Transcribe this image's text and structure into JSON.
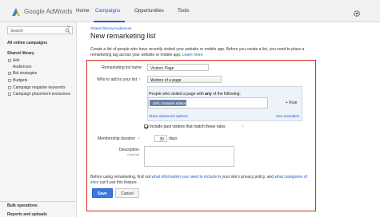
{
  "header": {
    "logo_text": "Google AdWords",
    "tabs": [
      {
        "label": "Home"
      },
      {
        "label": "Campaigns"
      },
      {
        "label": "Opportunities"
      },
      {
        "label": "Tools"
      }
    ],
    "active_tab": "Campaigns",
    "accent_color": "#1a5fcf"
  },
  "sidebar": {
    "search_placeholder": "Search",
    "all_campaigns": "All online campaigns",
    "shared_library": "Shared library",
    "items": [
      {
        "label": "Ads"
      },
      {
        "label": "Audiences"
      },
      {
        "label": "Bid strategies"
      },
      {
        "label": "Budgets"
      },
      {
        "label": "Campaign negative keywords"
      },
      {
        "label": "Campaign placement exclusions"
      }
    ],
    "bulk_operations": "Bulk operations",
    "reports_uploads": "Reports and uploads"
  },
  "main": {
    "breadcrumb": "Shared library/Audiences",
    "title": "New remarketing list",
    "intro_text": "Create a list of people who have recently visited your website or mobile app. Before you create a list, you need to place a remarketing tag across your website or mobile app.",
    "intro_link": "Learn more",
    "form": {
      "list_name_label": "Remarketing list name",
      "list_name_value": "Visitors Page",
      "who_label": "Who to add to your list",
      "who_value": "Visitors of a page",
      "rule_prefix": "People who visited a page with",
      "rule_any": "any",
      "rule_suffix": "of the following:",
      "rule_chip": "URL contains adwords",
      "add_rule": "+ Rule",
      "advanced_options": "Show advanced options",
      "see_examples": "See examples",
      "include_past_label": "Include past visitors that match these rules",
      "include_past_checked": true,
      "membership_label": "Membership duration",
      "membership_value": "30",
      "membership_unit": "days",
      "description_label": "Description",
      "description_optional": "Optional"
    },
    "footnote": {
      "prefix": "Before using remarketing, find out",
      "link1": "what information you need to include",
      "middle": "in your site's privacy policy, and",
      "link2": "what categories of sites",
      "suffix": "can't use this feature."
    },
    "save_label": "Save",
    "cancel_label": "Cancel"
  },
  "icons": {
    "gear": "gear-icon",
    "search": "search-icon",
    "help": "help-icon"
  }
}
